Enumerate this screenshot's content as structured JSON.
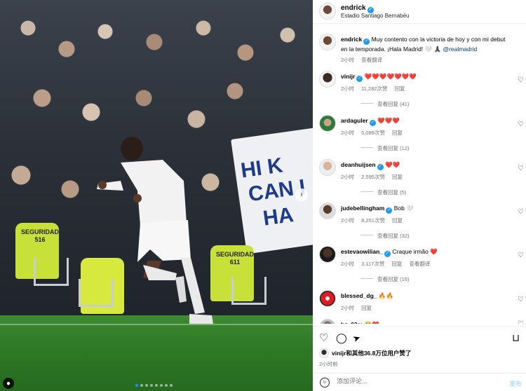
{
  "media": {
    "carousel_next_glyph": "›",
    "dots_total": 8,
    "dots_active_index": 0,
    "user_tag_glyph": "●",
    "steward_1_tag": "SEGURIDAD\n516",
    "steward_2_tag": "SEGURIDAD\n611",
    "banner_text": "HI K Y CAN I HA"
  },
  "header": {
    "username": "endrick",
    "location": "Estadio Santiago Bernabéu"
  },
  "caption": {
    "username": "endrick",
    "text": "Muy contento con la victoria de hoy y con mi debut en la temporada. ¡Hala Madrid! 🤍 🙏🏿 ",
    "mention": "@realmadrid",
    "time": "2小时",
    "translate": "查看翻译"
  },
  "comments": [
    {
      "username": "vinijr",
      "text": "❤️❤️❤️❤️❤️❤️❤️",
      "time": "2小时",
      "likes": "11,282次赞",
      "reply": "回复",
      "more": "查看回复 (41)"
    },
    {
      "username": "ardaguler",
      "text": "❤️❤️❤️",
      "time": "2小时",
      "likes": "5,089次赞",
      "reply": "回复",
      "more": "查看回复 (12)"
    },
    {
      "username": "deanhuijsen",
      "text": "❤️❤️",
      "time": "2小时",
      "likes": "2,595次赞",
      "reply": "回复",
      "more": "查看回复 (5)"
    },
    {
      "username": "judebellingham",
      "text": "Bob 🤍",
      "time": "2小时",
      "likes": "8,251次赞",
      "reply": "回复",
      "more": "查看回复 (32)"
    },
    {
      "username": "estevaowilian_",
      "text": "Craque irmão ❤️",
      "time": "2小时",
      "likes": "3,117次赞",
      "reply": "回复",
      "translate": "查看翻译",
      "more": "查看回复 (16)"
    },
    {
      "username": "blessed_dg_",
      "text": "🔥🔥",
      "time": "2小时",
      "reply": "回复"
    },
    {
      "username": "bz_03m",
      "text": "😂❤️"
    }
  ],
  "actions": {
    "like_icon": "♡",
    "comment_icon": "◯",
    "share_icon": "➤",
    "save_icon": "⊓"
  },
  "likes_summary": {
    "user": "vinijr",
    "text": "和其他36.8万位用户赞了"
  },
  "post_time": "2小时前",
  "composer": {
    "placeholder": "添加评论...",
    "post_label": "发布"
  }
}
